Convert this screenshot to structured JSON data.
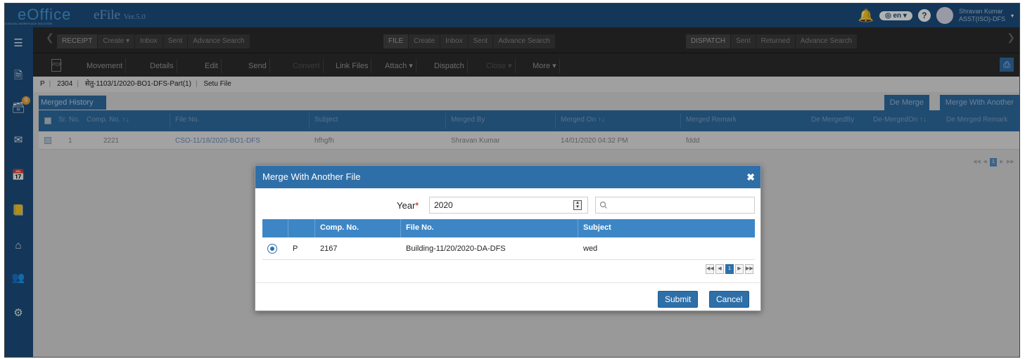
{
  "header": {
    "logo": "eOffice",
    "logo_sub": "A DIGITAL WORKPLACE SOLUTION",
    "app": "eFile",
    "version": "Ver.5.0",
    "lang": "en",
    "user_name": "Shravan Kumar",
    "user_role": "ASST(ISO)-DFS"
  },
  "menubar": {
    "receipt": [
      "RECEIPT",
      "Create",
      "Inbox",
      "Sent",
      "Advance Search"
    ],
    "file": [
      "FILE",
      "Create",
      "Inbox",
      "Sent",
      "Advance Search"
    ],
    "dispatch": [
      "DISPATCH",
      "Sent",
      "Returned",
      "Advance Search"
    ]
  },
  "toolbar": {
    "doc_icon": "PDF",
    "movement": "Movement",
    "details": "Details",
    "edit": "Edit",
    "send": "Send",
    "convert": "Convert",
    "link_files": "Link Files",
    "attach": "Attach",
    "dispatch": "Dispatch",
    "close": "Close",
    "more": "More"
  },
  "breadcrumb": {
    "type": "P",
    "comp_no": "2304",
    "file_no": "सेतु-1103/1/2020-BO1-DFS-Part(1)",
    "file_name": "Setu File"
  },
  "merged_history": {
    "tab_label": "Merged History",
    "de_merge": "De Merge",
    "merge_with_another": "Merge With Another",
    "columns": [
      "Sr. No.",
      "Comp. No. ↑↓",
      "File No.",
      "Subject",
      "Merged By",
      "Merged On ↑↓",
      "Merged Remark",
      "De MergedBy",
      "De-MergedOn ↑↓",
      "De Merged Remark"
    ],
    "rows": [
      {
        "sr": "1",
        "comp": "2221",
        "file": "CSO-11/18/2020-BO1-DFS",
        "subject": "hfhgfh",
        "merged_by": "Shravan Kumar",
        "merged_on": "14/01/2020 04:32 PM",
        "remark": "fddd"
      }
    ],
    "pager_current": "1"
  },
  "modal": {
    "title": "Merge With Another File",
    "year_label": "Year",
    "year_required": "*",
    "year_value": "2020",
    "search_placeholder": "",
    "columns": [
      "Comp. No.",
      "File No.",
      "Subject"
    ],
    "rows": [
      {
        "type": "P",
        "comp": "2167",
        "file": "Building-11/20/2020-DA-DFS",
        "subject": "wed",
        "selected": true
      }
    ],
    "pager_current": "1",
    "submit": "Submit",
    "cancel": "Cancel"
  }
}
